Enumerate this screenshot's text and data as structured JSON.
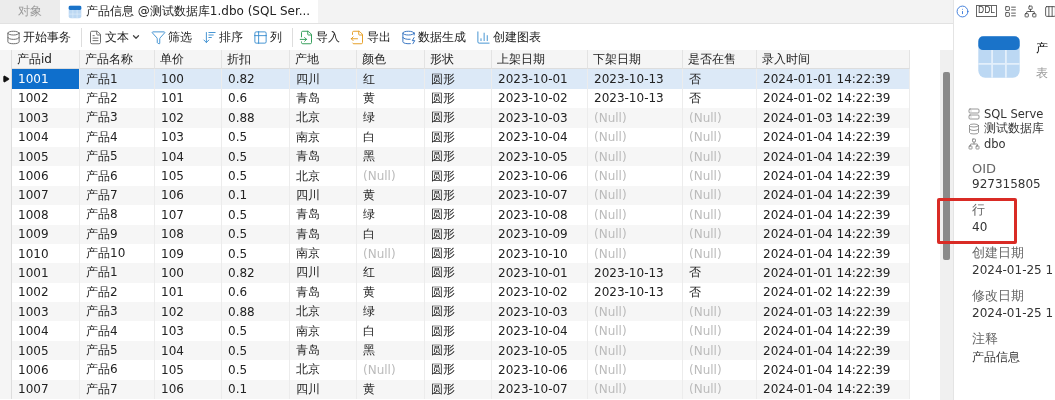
{
  "tabs": [
    {
      "label": "对象",
      "selected": false,
      "kind": "plain"
    },
    {
      "label": "产品信息 @测试数据库1.dbo (SQL Ser...",
      "selected": true,
      "kind": "table"
    }
  ],
  "toolbar": [
    [
      {
        "kind": "transaction",
        "label": "开始事务"
      }
    ],
    [
      {
        "kind": "text",
        "label": "文本",
        "dropdown": true
      },
      {
        "kind": "filter",
        "label": "筛选",
        "dropdown": false
      },
      {
        "kind": "sort",
        "label": "排序",
        "dropdown": false
      },
      {
        "kind": "columns",
        "label": "列",
        "dropdown": false
      }
    ],
    [
      {
        "kind": "import",
        "label": "导入"
      },
      {
        "kind": "export",
        "label": "导出"
      },
      {
        "kind": "generate",
        "label": "数据生成"
      },
      {
        "kind": "chart",
        "label": "创建图表"
      }
    ]
  ],
  "side_toolbar": [
    {
      "kind": "info"
    },
    {
      "kind": "ddl",
      "label": "DDL"
    },
    {
      "kind": "fields"
    },
    {
      "kind": "relations"
    },
    {
      "kind": "layout"
    }
  ],
  "table": {
    "columns": [
      "产品id",
      "产品名称",
      "单价",
      "折扣",
      "产地",
      "颜色",
      "形状",
      "上架日期",
      "下架日期",
      "是否在售",
      "录入时间"
    ],
    "rows": [
      {
        "selected": true,
        "cells": [
          "1001",
          "产品1",
          "100",
          "0.82",
          "四川",
          "红",
          "圆形",
          "2023-10-01",
          "2023-10-13",
          "否",
          "2024-01-01 14:22:39"
        ]
      },
      {
        "selected": false,
        "cells": [
          "1002",
          "产品2",
          "101",
          "0.6",
          "青岛",
          "黄",
          "圆形",
          "2023-10-02",
          "2023-10-13",
          "否",
          "2024-01-02 14:22:39"
        ]
      },
      {
        "selected": false,
        "cells": [
          "1003",
          "产品3",
          "102",
          "0.88",
          "北京",
          "绿",
          "圆形",
          "2023-10-03",
          {
            "text": "(Null)",
            "kind": "null"
          },
          {
            "text": "(Null)",
            "kind": "null"
          },
          "2024-01-03 14:22:39"
        ]
      },
      {
        "selected": false,
        "cells": [
          "1004",
          "产品4",
          "103",
          "0.5",
          "南京",
          "白",
          "圆形",
          "2023-10-04",
          {
            "text": "(Null)",
            "kind": "null"
          },
          {
            "text": "(Null)",
            "kind": "null"
          },
          "2024-01-04 14:22:39"
        ]
      },
      {
        "selected": false,
        "cells": [
          "1005",
          "产品5",
          "104",
          "0.5",
          "青岛",
          "黑",
          "圆形",
          "2023-10-05",
          {
            "text": "(Null)",
            "kind": "null"
          },
          {
            "text": "(Null)",
            "kind": "null"
          },
          "2024-01-04 14:22:39"
        ]
      },
      {
        "selected": false,
        "cells": [
          "1006",
          "产品6",
          "105",
          "0.5",
          "北京",
          {
            "text": "(Null)",
            "kind": "null"
          },
          "圆形",
          "2023-10-06",
          {
            "text": "(Null)",
            "kind": "null"
          },
          {
            "text": "(Null)",
            "kind": "null"
          },
          "2024-01-04 14:22:39"
        ]
      },
      {
        "selected": false,
        "cells": [
          "1007",
          "产品7",
          "106",
          "0.1",
          "四川",
          "黄",
          "圆形",
          "2023-10-07",
          {
            "text": "(Null)",
            "kind": "null"
          },
          {
            "text": "(Null)",
            "kind": "null"
          },
          "2024-01-04 14:22:39"
        ]
      },
      {
        "selected": false,
        "cells": [
          "1008",
          "产品8",
          "107",
          "0.5",
          "青岛",
          "绿",
          "圆形",
          "2023-10-08",
          {
            "text": "(Null)",
            "kind": "null"
          },
          {
            "text": "(Null)",
            "kind": "null"
          },
          "2024-01-04 14:22:39"
        ]
      },
      {
        "selected": false,
        "cells": [
          "1009",
          "产品9",
          "108",
          "0.5",
          "青岛",
          "白",
          "圆形",
          "2023-10-09",
          {
            "text": "(Null)",
            "kind": "null"
          },
          {
            "text": "(Null)",
            "kind": "null"
          },
          "2024-01-04 14:22:39"
        ]
      },
      {
        "selected": false,
        "cells": [
          "1010",
          "产品10",
          "109",
          "0.5",
          "南京",
          {
            "text": "(Null)",
            "kind": "null"
          },
          "圆形",
          "2023-10-10",
          {
            "text": "(Null)",
            "kind": "null"
          },
          {
            "text": "(Null)",
            "kind": "null"
          },
          "2024-01-04 14:22:39"
        ]
      },
      {
        "selected": false,
        "cells": [
          "1001",
          "产品1",
          "100",
          "0.82",
          "四川",
          "红",
          "圆形",
          "2023-10-01",
          "2023-10-13",
          "否",
          "2024-01-01 14:22:39"
        ]
      },
      {
        "selected": false,
        "cells": [
          "1002",
          "产品2",
          "101",
          "0.6",
          "青岛",
          "黄",
          "圆形",
          "2023-10-02",
          "2023-10-13",
          "否",
          "2024-01-02 14:22:39"
        ]
      },
      {
        "selected": false,
        "cells": [
          "1003",
          "产品3",
          "102",
          "0.88",
          "北京",
          "绿",
          "圆形",
          "2023-10-03",
          {
            "text": "(Null)",
            "kind": "null"
          },
          {
            "text": "(Null)",
            "kind": "null"
          },
          "2024-01-03 14:22:39"
        ]
      },
      {
        "selected": false,
        "cells": [
          "1004",
          "产品4",
          "103",
          "0.5",
          "南京",
          "白",
          "圆形",
          "2023-10-04",
          {
            "text": "(Null)",
            "kind": "null"
          },
          {
            "text": "(Null)",
            "kind": "null"
          },
          "2024-01-04 14:22:39"
        ]
      },
      {
        "selected": false,
        "cells": [
          "1005",
          "产品5",
          "104",
          "0.5",
          "青岛",
          "黑",
          "圆形",
          "2023-10-05",
          {
            "text": "(Null)",
            "kind": "null"
          },
          {
            "text": "(Null)",
            "kind": "null"
          },
          "2024-01-04 14:22:39"
        ]
      },
      {
        "selected": false,
        "cells": [
          "1006",
          "产品6",
          "105",
          "0.5",
          "北京",
          {
            "text": "(Null)",
            "kind": "null"
          },
          "圆形",
          "2023-10-06",
          {
            "text": "(Null)",
            "kind": "null"
          },
          {
            "text": "(Null)",
            "kind": "null"
          },
          "2024-01-04 14:22:39"
        ]
      },
      {
        "selected": false,
        "cells": [
          "1007",
          "产品7",
          "106",
          "0.1",
          "四川",
          "黄",
          "圆形",
          "2023-10-07",
          {
            "text": "(Null)",
            "kind": "null"
          },
          {
            "text": "(Null)",
            "kind": "null"
          },
          "2024-01-04 14:22:39"
        ]
      }
    ]
  },
  "info_panel": {
    "title": "产",
    "subtitle": "表",
    "sources": [
      {
        "kind": "server",
        "label": "SQL Serve"
      },
      {
        "kind": "database",
        "label": "测试数据库"
      },
      {
        "kind": "schema",
        "label": "dbo"
      }
    ],
    "properties": [
      {
        "label": "OID",
        "value": "927315805",
        "highlighted": false
      },
      {
        "label": "行",
        "value": "40",
        "highlighted": true
      },
      {
        "label": "创建日期",
        "value": "2024-01-25 1",
        "highlighted": false
      },
      {
        "label": "修改日期",
        "value": "2024-01-25 1",
        "highlighted": false
      },
      {
        "label": "注释",
        "value": "产品信息",
        "highlighted": false
      }
    ]
  }
}
